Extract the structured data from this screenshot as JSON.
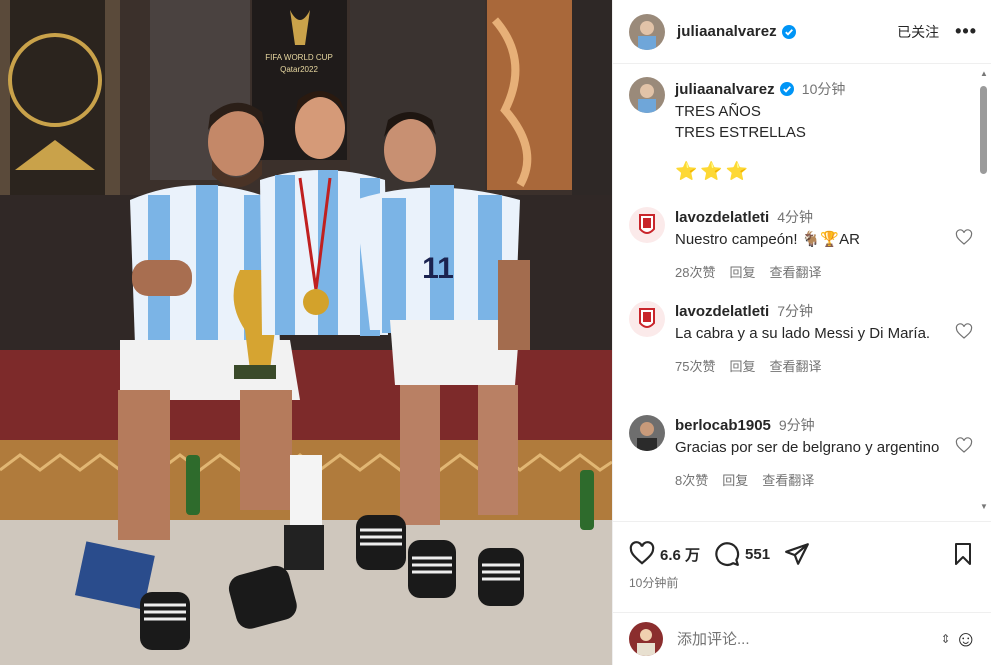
{
  "post": {
    "username": "juliaanalvarez",
    "follow_label": "已关注",
    "more_label": "•••"
  },
  "caption": {
    "username": "juliaanalvarez",
    "time": "10分钟",
    "line1": "TRES AÑOS",
    "line2": "TRES ESTRELLAS",
    "stars": "⭐⭐⭐"
  },
  "comments": [
    {
      "username": "lavozdelatleti",
      "time": "4分钟",
      "text": "Nuestro campeón! 🐐🏆AR",
      "likes": "28次赞",
      "reply": "回复",
      "translate": "查看翻译"
    },
    {
      "username": "lavozdelatleti",
      "time": "7分钟",
      "text": "La cabra y a su lado Messi y Di María.",
      "likes": "75次赞",
      "reply": "回复",
      "translate": "查看翻译"
    },
    {
      "username": "berlocab1905",
      "time": "9分钟",
      "text": "Gracias por ser de belgrano y argentino",
      "likes": "8次赞",
      "reply": "回复",
      "translate": "查看翻译"
    }
  ],
  "actions": {
    "likes": "6.6 万",
    "comments": "551",
    "post_time": "10分钟前"
  },
  "add_comment": {
    "placeholder": "添加评论..."
  },
  "photo": {
    "banner_text": "FIFA WORLD CUP",
    "banner_sub": "Qatar2022",
    "jersey_number": "11"
  },
  "colors": {
    "verified": "#0095f6",
    "star": "#f1b600",
    "meta_text": "#737373"
  }
}
